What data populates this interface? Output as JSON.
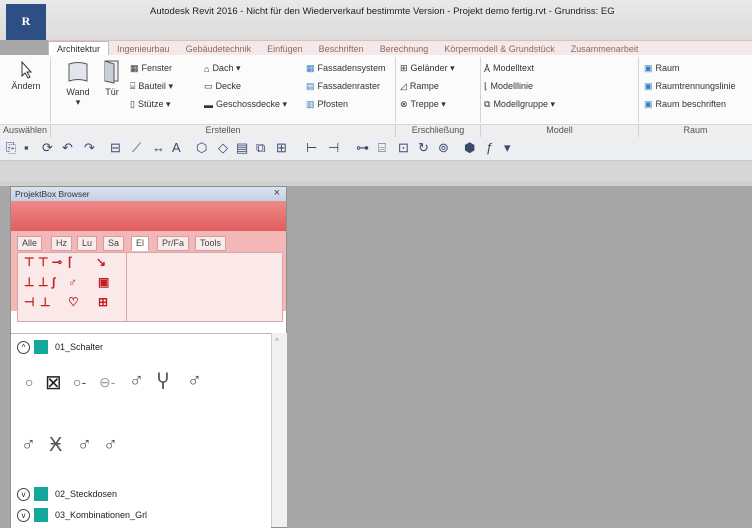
{
  "app": {
    "logo_letter": "R",
    "title": "Autodesk Revit 2016 - Nicht für den Wiederverkauf bestimmte Version -     Projekt demo fertig.rvt - Grundriss: EG"
  },
  "tabs": [
    "Architektur",
    "Ingenieurbau",
    "Gebäudetechnik",
    "Einfügen",
    "Beschriften",
    "Berechnung",
    "Körpermodell & Grundstück",
    "Zusammenarbeit"
  ],
  "ribbon": {
    "aendern": "Ändern",
    "wand": "Wand",
    "tuer": "Tür",
    "fenster": "Fenster",
    "bauteil": "Bauteil",
    "stuetze": "Stütze",
    "dach": "Dach",
    "decke": "Decke",
    "geschossdecke": "Geschossdecke",
    "fassadensystem": "Fassadensystem",
    "fassadenraster": "Fassadenraster",
    "pfosten": "Pfosten",
    "gelaender": "Geländer",
    "rampe": "Rampe",
    "treppe": "Treppe",
    "modelltext": "Modelltext",
    "modelllinie": "Modelllinie",
    "modellgruppe": "Modellgruppe",
    "raum": "Raum",
    "raumtrennung": "Raumtrennungslinie",
    "raum_beschriften": "Raum beschriften",
    "panels": {
      "auswaehlen": "Auswählen ▾",
      "erstellen": "Erstellen",
      "erschliessung": "Erschließung",
      "modell": "Modell",
      "raum": "Raum"
    }
  },
  "browser": {
    "title": "ProjektBox Browser",
    "close": "×",
    "tabs": [
      "Alle",
      "Hz",
      "Lu",
      "Sa",
      "El",
      "Pr/Fa",
      "Tools"
    ],
    "active_tab": "El",
    "groups": [
      {
        "label": "01_Schalter",
        "state": "expanded"
      },
      {
        "label": "02_Steckdosen",
        "state": "collapsed"
      },
      {
        "label": "03_Kombinationen_Grl",
        "state": "collapsed"
      }
    ]
  },
  "colors": {
    "accent": "#e05d5d",
    "teal": "#15a79c",
    "revit_blue": "#2e4f86"
  }
}
